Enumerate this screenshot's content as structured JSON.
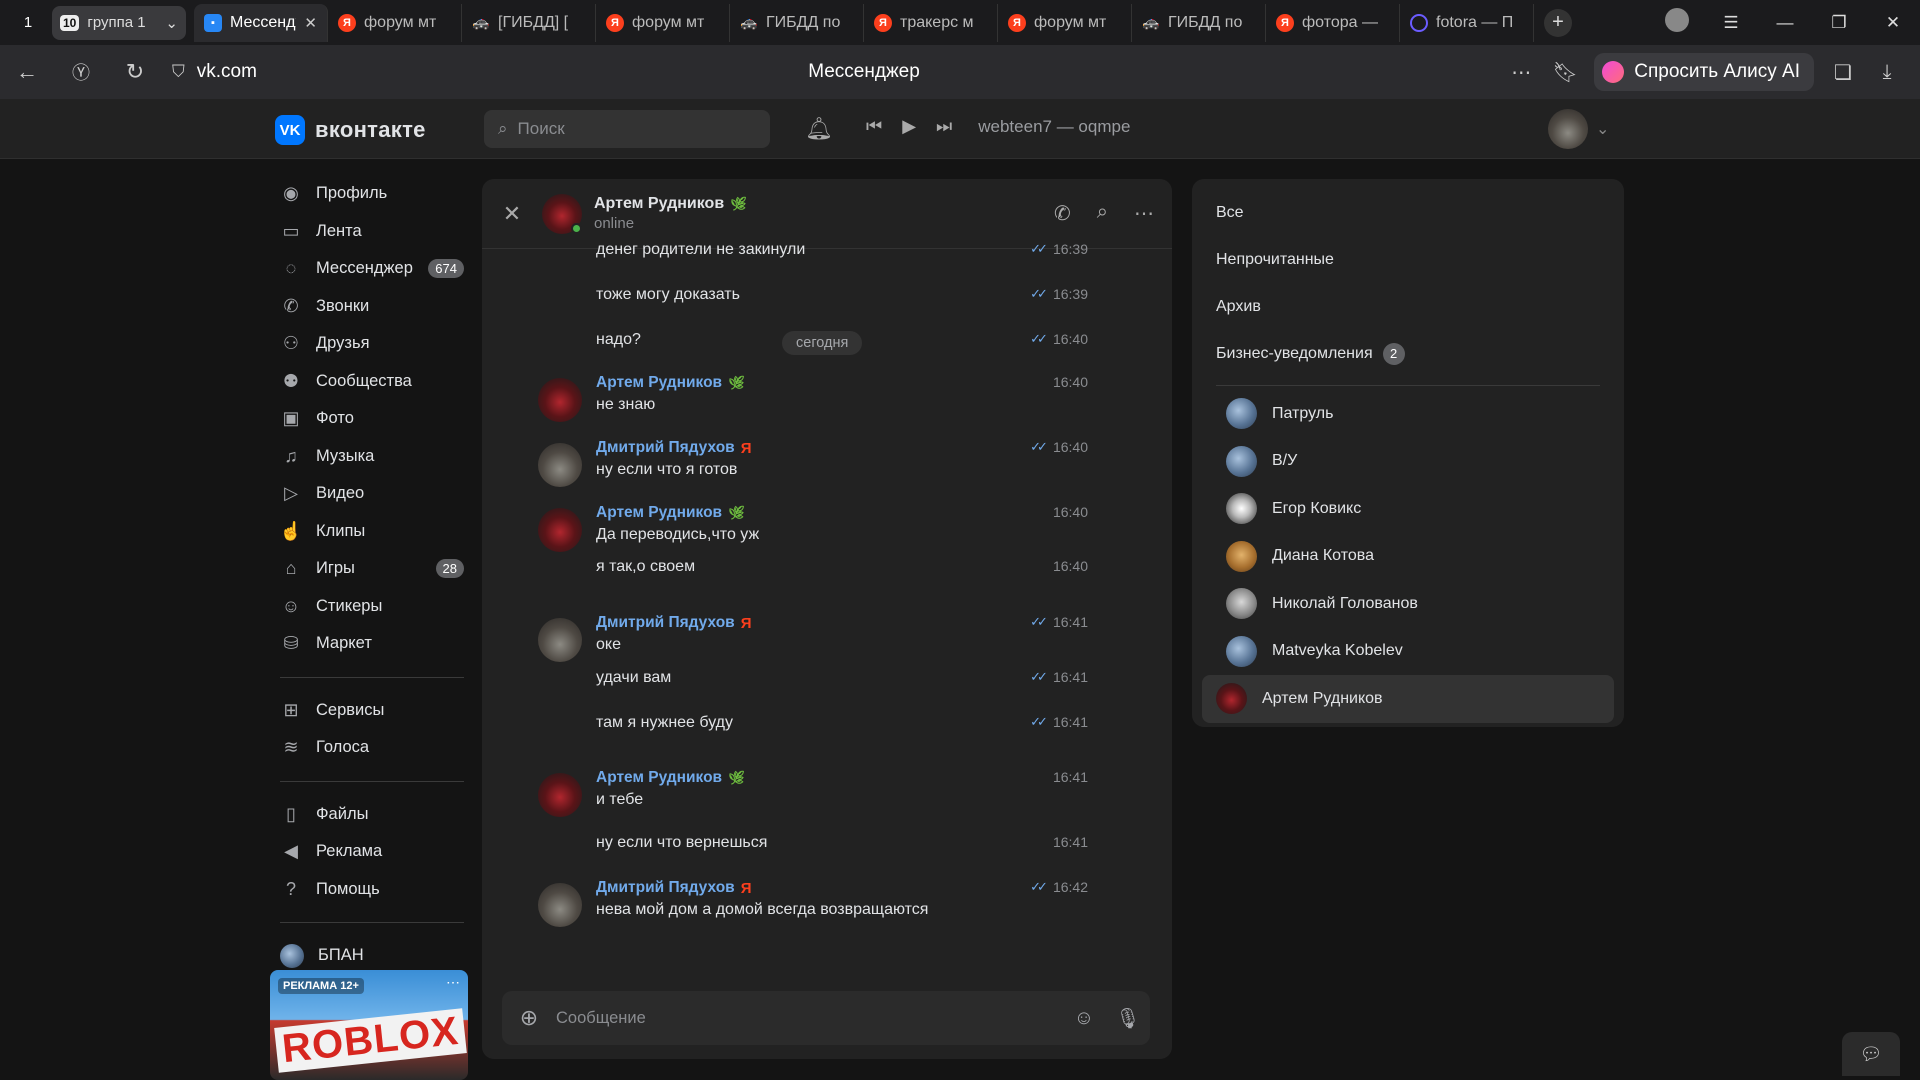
{
  "browser": {
    "tab_count": "1",
    "group": {
      "count": "10",
      "label": "группа 1"
    },
    "tabs": [
      {
        "label": "Мессенджер",
        "favicon": "vk-messenger-icon",
        "active": true
      },
      {
        "label": "форум мт",
        "favicon": "yandex-icon"
      },
      {
        "label": "[ГИБДД] [",
        "favicon": "car-icon"
      },
      {
        "label": "форум мт",
        "favicon": "yandex-icon"
      },
      {
        "label": "ГИБДД по",
        "favicon": "car-icon"
      },
      {
        "label": "тракерс м",
        "favicon": "yandex-icon"
      },
      {
        "label": "форум мт",
        "favicon": "yandex-icon"
      },
      {
        "label": "ГИБДД по",
        "favicon": "car-icon"
      },
      {
        "label": "фотора —",
        "favicon": "yandex-icon"
      },
      {
        "label": "fotora — П",
        "favicon": "ring-icon"
      }
    ],
    "url": "vk.com",
    "page_title": "Мессенджер",
    "alice_label": "Спросить Алису AI"
  },
  "vk": {
    "logo_text": "вконтакте",
    "search_placeholder": "Поиск",
    "player_track": "webteen7 — oqmpe",
    "nav": [
      {
        "label": "Профиль",
        "icon": "profile-icon"
      },
      {
        "label": "Лента",
        "icon": "feed-icon"
      },
      {
        "label": "Мессенджер",
        "icon": "messenger-icon",
        "badge": "674"
      },
      {
        "label": "Звонки",
        "icon": "phone-icon"
      },
      {
        "label": "Друзья",
        "icon": "friends-icon"
      },
      {
        "label": "Сообщества",
        "icon": "communities-icon"
      },
      {
        "label": "Фото",
        "icon": "photo-icon"
      },
      {
        "label": "Музыка",
        "icon": "music-icon"
      },
      {
        "label": "Видео",
        "icon": "video-icon"
      },
      {
        "label": "Клипы",
        "icon": "clips-icon"
      },
      {
        "label": "Игры",
        "icon": "games-icon",
        "badge": "28"
      },
      {
        "label": "Стикеры",
        "icon": "stickers-icon"
      },
      {
        "label": "Маркет",
        "icon": "market-icon"
      }
    ],
    "nav2": [
      {
        "label": "Сервисы",
        "icon": "services-icon"
      },
      {
        "label": "Голоса",
        "icon": "votes-icon"
      }
    ],
    "nav3": [
      {
        "label": "Файлы",
        "icon": "files-icon"
      },
      {
        "label": "Реклама",
        "icon": "ads-icon"
      },
      {
        "label": "Помощь",
        "icon": "help-icon"
      }
    ],
    "nav4": [
      {
        "label": "БПАН"
      }
    ],
    "ad": {
      "tag": "РЕКЛАМА 12+",
      "word": "ROBLOX"
    }
  },
  "chat": {
    "name": "Артем Рудников",
    "status": "online",
    "date_separator": "сегодня",
    "composer_placeholder": "Сообщение",
    "messages": [
      {
        "text": "денег родители не закинули",
        "time": "16:39",
        "read": true
      },
      {
        "text": "тоже могу доказать",
        "time": "16:39",
        "read": true
      },
      {
        "text": "надо?",
        "time": "16:40",
        "read": true
      },
      {
        "author": "Артем Рудников",
        "mark": "leaf",
        "text": "не знаю",
        "time": "16:40",
        "read": false
      },
      {
        "author": "Дмитрий Пядухов",
        "mark": "ya",
        "text": "ну если что я готов",
        "time": "16:40",
        "read": true
      },
      {
        "author": "Артем Рудников",
        "mark": "leaf",
        "text": "Да переводись,что уж",
        "time": "16:40",
        "read": false
      },
      {
        "text": "я так,о своем",
        "time": "16:40",
        "read": false
      },
      {
        "author": "Дмитрий Пядухов",
        "mark": "ya",
        "text": "оке",
        "time": "16:41",
        "read": true
      },
      {
        "text": "удачи вам",
        "time": "16:41",
        "read": true
      },
      {
        "text": "там я нужнее буду",
        "time": "16:41",
        "read": true
      },
      {
        "author": "Артем Рудников",
        "mark": "leaf",
        "text": "и тебе",
        "time": "16:41",
        "read": false
      },
      {
        "text": "ну если что вернешься",
        "time": "16:41",
        "read": false
      },
      {
        "author": "Дмитрий Пядухов",
        "mark": "ya",
        "text": "нева мой дом а домой всегда возвращаются",
        "time": "16:42",
        "read": true
      }
    ]
  },
  "folders": {
    "items": [
      {
        "label": "Все"
      },
      {
        "label": "Непрочитанные"
      },
      {
        "label": "Архив"
      },
      {
        "label": "Бизнес-уведомления",
        "badge": "2"
      }
    ],
    "conversations": [
      {
        "name": "Патруль",
        "avatar": "sky"
      },
      {
        "name": "В/У",
        "avatar": "sky"
      },
      {
        "name": "Егор Ковикс",
        "avatar": "bw"
      },
      {
        "name": "Диана Котова",
        "avatar": "gold"
      },
      {
        "name": "Николай Голованов",
        "avatar": "grey"
      },
      {
        "name": "Matveyka Kobelev",
        "avatar": "sky"
      },
      {
        "name": "Артем Рудников",
        "avatar": "red",
        "selected": true
      }
    ]
  }
}
